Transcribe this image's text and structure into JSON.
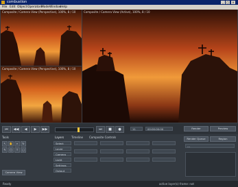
{
  "window": {
    "title": "combustion"
  },
  "menu": [
    "File",
    "Edit",
    "Object",
    "Operators",
    "Mode",
    "Window",
    "Help"
  ],
  "viewers": {
    "top_left": "Composite / Camera View (Perspective), 100%, 8 / 10",
    "bottom_left": "Composite / Camera View (Perspective), 100%, 8 / 10",
    "main": "Composite / Camera View (Active), 100%, 8 / 10"
  },
  "transport": {
    "buttons": [
      "⏮",
      "◀◀",
      "◀",
      "▶",
      "▶▶",
      "⏭",
      "■",
      "●"
    ],
    "frame": "11",
    "timecode": "00:00:00:00"
  },
  "right_panel": {
    "buttons": [
      "Render",
      "Preview",
      "Render Queue",
      "Region"
    ],
    "value_readout": "---"
  },
  "toolbar": {
    "label": "Tools"
  },
  "tabs": [
    "Layers",
    "Timeline",
    "Composite Controls"
  ],
  "left_list": [
    "Select",
    "Layer",
    "Camera",
    "Light",
    "Settings",
    "Output"
  ],
  "bottom_left_button": "Camera View",
  "status": {
    "left": "Ready",
    "right": "active layer(s) frame: not"
  }
}
